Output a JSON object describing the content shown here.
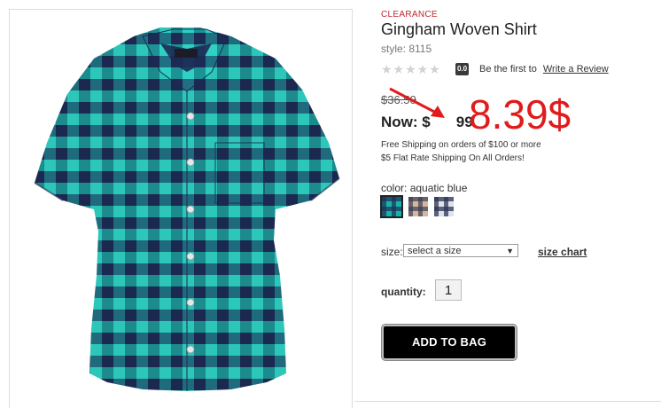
{
  "product": {
    "badge": "CLEARANCE",
    "title": "Gingham Woven Shirt",
    "style": "style: 8115",
    "rating": {
      "stars": "★★★★★",
      "score": "0.0",
      "prompt": "Be the first to",
      "review_link": "Write a Review"
    },
    "price": {
      "original": "$36.50",
      "now_label": "Now: $",
      "now_cents": "99",
      "annotation": "8.39$"
    },
    "shipping": [
      "Free Shipping on orders of $100 or more",
      "$5 Flat Rate Shipping On All Orders!"
    ],
    "color": {
      "label_prefix": "color:",
      "selected": "aquatic blue"
    },
    "swatches": [
      {
        "name": "aquatic blue",
        "colors": [
          "#16b2a8",
          "#1f2f57"
        ]
      },
      {
        "name": "tan plaid",
        "colors": [
          "#d7b79c",
          "#3a3f55"
        ]
      },
      {
        "name": "navy plaid",
        "colors": [
          "#dfe2ea",
          "#2c3655"
        ]
      }
    ],
    "size": {
      "label": "size:",
      "placeholder": "select a size",
      "chart_link": "size chart"
    },
    "quantity": {
      "label": "quantity:",
      "value": "1"
    },
    "add_to_bag": "ADD TO BAG"
  },
  "colors": {
    "clearance": "#c0262d",
    "annotation": "#e11b1b",
    "button_bg": "#000000",
    "shirt_teal": "#1bb3a8",
    "shirt_navy": "#1d2b55"
  },
  "icons": [
    "star-icon",
    "dropdown-caret-icon",
    "annotation-arrow-icon"
  ]
}
